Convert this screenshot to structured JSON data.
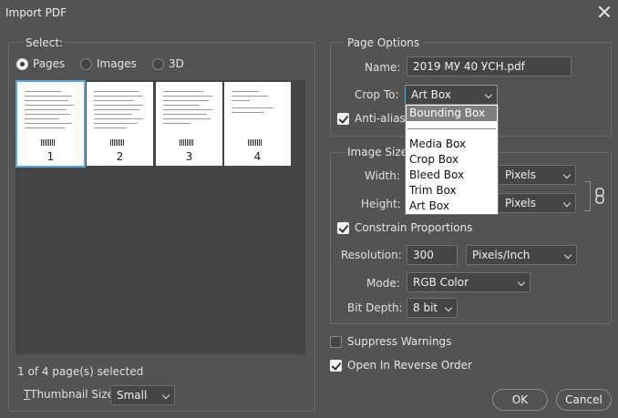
{
  "window": {
    "title": "Import PDF"
  },
  "select_panel": {
    "legend": "Select:",
    "radios": [
      {
        "label": "Pages",
        "checked": true
      },
      {
        "label": "Images",
        "checked": false
      },
      {
        "label": "3D",
        "checked": false
      }
    ],
    "thumbnails": [
      "1",
      "2",
      "3",
      "4"
    ],
    "status": "1 of 4 page(s) selected",
    "thumb_size_label": "Thumbnail Size:",
    "thumb_size_value": "Small"
  },
  "page_options": {
    "legend": "Page Options",
    "name_label": "Name:",
    "name_value": "2019 МУ 40 УСН.pdf",
    "crop_label": "Crop To:",
    "crop_value": "Art Box",
    "anti_alias_label": "Anti-aliased",
    "crop_options": [
      "Bounding Box",
      "Media Box",
      "Crop Box",
      "Bleed Box",
      "Trim Box",
      "Art Box"
    ]
  },
  "image_size": {
    "legend": "Image Size",
    "width_label": "Width:",
    "width_unit": "Pixels",
    "height_label": "Height:",
    "height_unit": "Pixels",
    "constrain_label": "Constrain Proportions",
    "resolution_label": "Resolution:",
    "resolution_value": "300",
    "resolution_unit": "Pixels/Inch",
    "mode_label": "Mode:",
    "mode_value": "RGB Color",
    "bitdepth_label": "Bit Depth:",
    "bitdepth_value": "8 bit"
  },
  "options": {
    "suppress_warnings": "Suppress Warnings",
    "reverse_order": "Open In Reverse Order"
  },
  "buttons": {
    "ok": "OK",
    "cancel": "Cancel"
  }
}
